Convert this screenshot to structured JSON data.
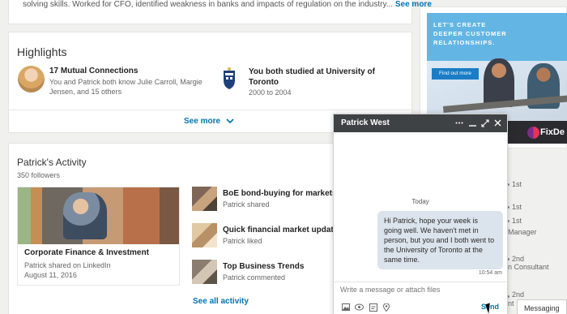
{
  "summary": {
    "text": "solving skills. Worked for CFO, identified weakness in banks and impacts of regulation on the industry...",
    "see_more": "See more"
  },
  "highlights": {
    "title": "Highlights",
    "mutual": {
      "title": "17 Mutual Connections",
      "line1": "You and Patrick both know Julie Carroll, Margie",
      "line2": "Jensen, and 15 others"
    },
    "school": {
      "line1": "You both studied at University of",
      "line2": "Toronto",
      "years": "2000 to 2004"
    },
    "see_more": "See more",
    "see_more_icon": "chevron-down-icon"
  },
  "activity": {
    "title": "Patrick's Activity",
    "followers": "350 followers",
    "post": {
      "title": "Corporate Finance & Investment",
      "subtitle": "Patrick shared on LinkedIn",
      "date": "August 11, 2016"
    },
    "items": [
      {
        "title": "BoE bond-buying for markets",
        "sub": "Patrick shared"
      },
      {
        "title": "Quick financial market update",
        "sub": "Patrick liked"
      },
      {
        "title": "Top Business Trends",
        "sub": "Patrick commented"
      }
    ],
    "see_all": "See all activity"
  },
  "ad": {
    "headline": "LET'S CREATE\nDEEPER CUSTOMER\nRELATIONSHIPS.",
    "button": "Find out more",
    "brand": "FixDe"
  },
  "right_column": {
    "degrees": [
      "1st",
      "1st",
      "1st",
      "2nd",
      "1st"
    ],
    "titles": [
      "Manager",
      "n Consultant",
      "nt"
    ]
  },
  "chat": {
    "name": "Patrick West",
    "header_icons": [
      "more-icon",
      "minimize-icon",
      "expand-icon",
      "close-icon"
    ],
    "day": "Today",
    "message": "Hi Patrick, hope your week is going well. We haven't met in person, but you and I both went to the University of Toronto at the same time.",
    "time": "10:54 am",
    "input_placeholder": "Write a message or attach files",
    "tools": [
      "image-icon",
      "attachment-icon",
      "gif-icon",
      "location-icon"
    ],
    "send": "Send"
  },
  "messaging_tab": "Messaging",
  "colors": {
    "link": "#0073b1",
    "chat_header": "#3f4244",
    "bubble": "#dbe3ec",
    "ad_banner": "#63b5e4"
  }
}
